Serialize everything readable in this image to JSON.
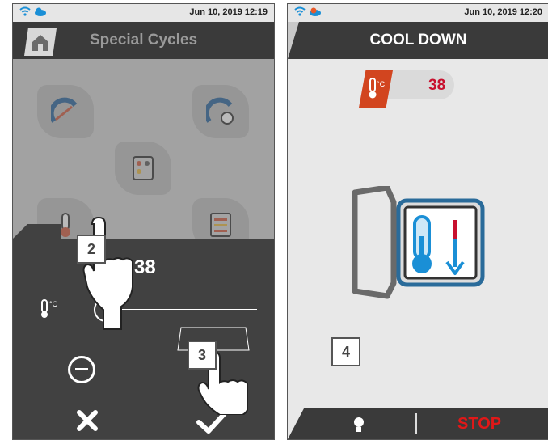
{
  "left_screen": {
    "status": {
      "datetime": "Jun 10, 2019 12:19",
      "icons": [
        "wifi-icon",
        "cloud-icon"
      ]
    },
    "title": "Special Cycles",
    "tiles": [
      "dry-cycle-icon",
      "delayed-start-icon",
      "program-card-icon",
      "thermometer-icon",
      "trays-icon"
    ],
    "panel": {
      "value": "38",
      "slider_icon": "thermometer-celsius-icon",
      "minus_icon": "minus-circle-icon",
      "cancel_icon": "close-icon",
      "confirm_icon": "check-icon"
    },
    "callouts": [
      "2",
      "3"
    ]
  },
  "right_screen": {
    "status": {
      "datetime": "Jun 10, 2019 12:20",
      "icons": [
        "wifi-icon",
        "cloud-icon"
      ]
    },
    "title": "COOL DOWN",
    "temperature": "38",
    "callout": "4",
    "bottom_bar": {
      "light_icon": "bulb-icon",
      "stop_label": "STOP"
    }
  },
  "colors": {
    "accent_red": "#c8102e",
    "stop_red": "#e01818",
    "bar_dark": "#3a3a3a",
    "badge_orange": "#d2451f",
    "cool_blue": "#1a8fd6"
  }
}
